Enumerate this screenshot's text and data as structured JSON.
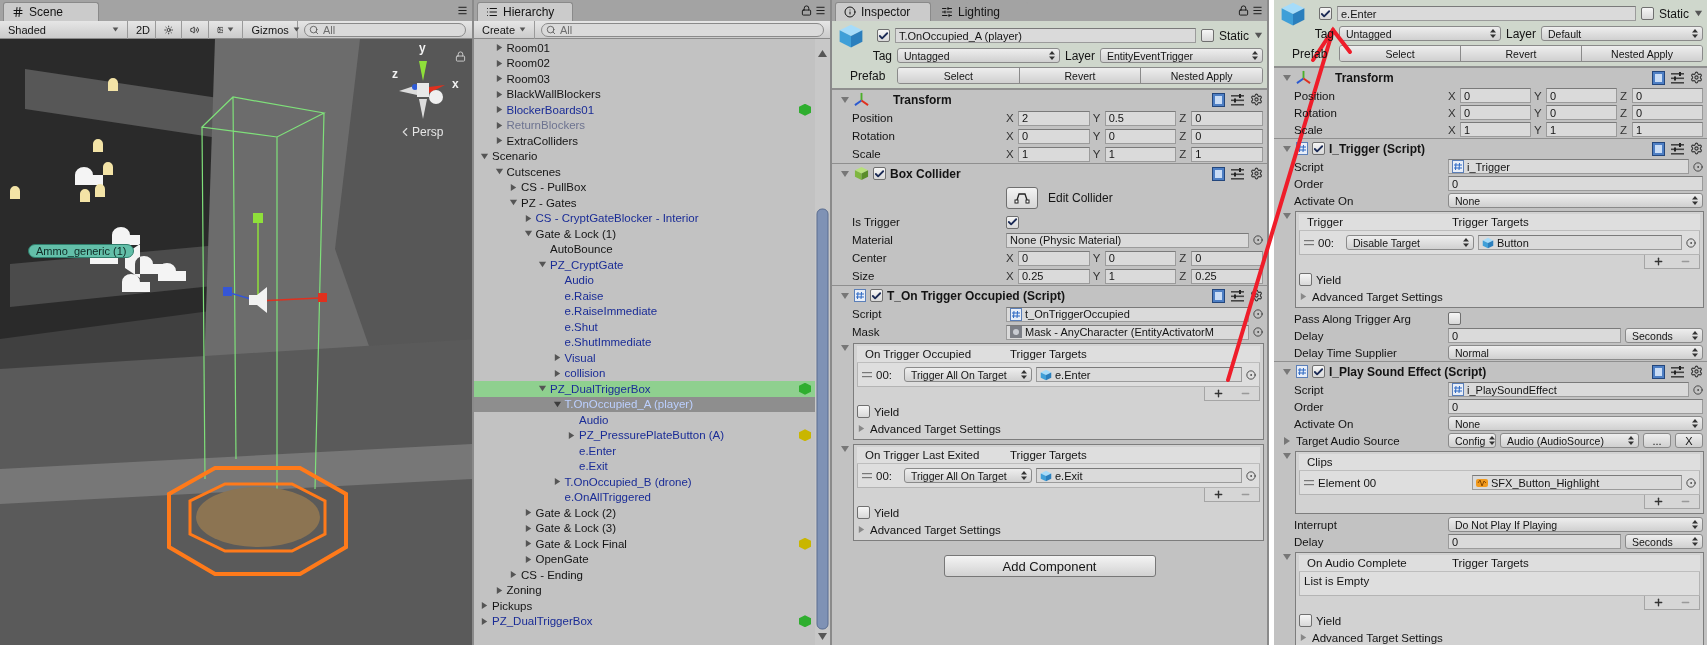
{
  "scene": {
    "tab": "Scene",
    "toolbar": {
      "draw_mode": "Shaded",
      "mode_2d": "2D",
      "lighting_on": false,
      "audio_on": false,
      "gizmos": "Gizmos",
      "search_placeholder": "All"
    },
    "axis_labels": [
      "y",
      "z",
      "x"
    ],
    "projection": "Persp",
    "object_label": "Ammo_generic (1)"
  },
  "hierarchy": {
    "tab": "Hierarchy",
    "create": "Create",
    "search_placeholder": "All",
    "tree": [
      {
        "children": [
          {
            "label": "Room01",
            "kind": "object",
            "expanded": false,
            "selected": false,
            "highlighted": false
          },
          {
            "label": "Room02",
            "kind": "object",
            "expanded": false,
            "selected": false,
            "highlighted": false
          },
          {
            "label": "Room03",
            "kind": "object",
            "expanded": false,
            "selected": false,
            "highlighted": false
          },
          {
            "label": "BlackWallBlockers",
            "kind": "object",
            "expanded": false,
            "selected": false,
            "highlighted": false
          },
          {
            "label": "BlockerBoards01",
            "kind": "prefab",
            "expanded": false,
            "selected": false,
            "highlighted": false,
            "color": "#2fae2f"
          },
          {
            "label": "ReturnBlockers",
            "kind": "inactive_prefab",
            "expanded": false,
            "selected": false,
            "highlighted": false
          },
          {
            "label": "ExtraColliders",
            "kind": "object",
            "expanded": false,
            "selected": false,
            "highlighted": false
          }
        ]
      },
      {
        "label": "Scenario",
        "kind": "object",
        "expanded": true,
        "selected": false,
        "highlighted": false,
        "children": [
          {
            "label": "Cutscenes",
            "kind": "object",
            "expanded": true,
            "selected": false,
            "highlighted": false,
            "children": [
              {
                "label": "CS - PullBox",
                "kind": "object",
                "expanded": false,
                "selected": false,
                "highlighted": false
              },
              {
                "label": "PZ - Gates",
                "kind": "object",
                "expanded": true,
                "selected": false,
                "highlighted": false,
                "children": [
                  {
                    "label": "CS - CryptGateBlocker - Interior",
                    "kind": "prefab",
                    "expanded": false,
                    "selected": false,
                    "highlighted": false
                  },
                  {
                    "label": "Gate & Lock (1)",
                    "kind": "object",
                    "expanded": true,
                    "selected": false,
                    "highlighted": false,
                    "children": [
                      {
                        "label": "AutoBounce",
                        "kind": "object",
                        "selected": false,
                        "highlighted": false
                      },
                      {
                        "label": "PZ_CryptGate",
                        "kind": "prefab",
                        "expanded": true,
                        "selected": false,
                        "highlighted": false,
                        "children": [
                          {
                            "label": "Audio",
                            "kind": "prefab",
                            "selected": false,
                            "highlighted": false
                          },
                          {
                            "label": "e.Raise",
                            "kind": "prefab",
                            "selected": false,
                            "highlighted": false
                          },
                          {
                            "label": "e.RaiseImmediate",
                            "kind": "prefab",
                            "selected": false,
                            "highlighted": false
                          },
                          {
                            "label": "e.Shut",
                            "kind": "prefab",
                            "selected": false,
                            "highlighted": false
                          },
                          {
                            "label": "e.ShutImmediate",
                            "kind": "prefab",
                            "selected": false,
                            "highlighted": false
                          },
                          {
                            "label": "Visual",
                            "kind": "prefab",
                            "expanded": false,
                            "selected": false,
                            "highlighted": false
                          },
                          {
                            "label": "collision",
                            "kind": "prefab",
                            "expanded": false,
                            "selected": false,
                            "highlighted": false
                          }
                        ]
                      },
                      {
                        "label": "PZ_DualTriggerBox",
                        "kind": "prefab",
                        "expanded": true,
                        "selected": false,
                        "highlighted": true,
                        "color": "#2fae2f",
                        "children": [
                          {
                            "label": "T.OnOccupied_A (player)",
                            "kind": "prefab",
                            "expanded": true,
                            "selected": true,
                            "highlighted": false,
                            "children": [
                              {
                                "label": "Audio",
                                "kind": "prefab",
                                "selected": false,
                                "highlighted": false
                              },
                              {
                                "label": "PZ_PressurePlateButton (A)",
                                "kind": "prefab",
                                "expanded": false,
                                "selected": false,
                                "highlighted": false,
                                "color": "#c9b600"
                              },
                              {
                                "label": "e.Enter",
                                "kind": "prefab",
                                "selected": false,
                                "highlighted": false
                              },
                              {
                                "label": "e.Exit",
                                "kind": "prefab",
                                "selected": false,
                                "highlighted": false
                              }
                            ]
                          },
                          {
                            "label": "T.OnOccupied_B (drone)",
                            "kind": "prefab",
                            "expanded": false,
                            "selected": false,
                            "highlighted": false
                          },
                          {
                            "label": "e.OnAllTriggered",
                            "kind": "prefab",
                            "selected": false,
                            "highlighted": false
                          }
                        ]
                      }
                    ]
                  },
                  {
                    "label": "Gate & Lock (2)",
                    "kind": "object",
                    "expanded": false,
                    "selected": false,
                    "highlighted": false
                  },
                  {
                    "label": "Gate & Lock (3)",
                    "kind": "object",
                    "expanded": false,
                    "selected": false,
                    "highlighted": false
                  },
                  {
                    "label": "Gate & Lock Final",
                    "kind": "object",
                    "expanded": false,
                    "selected": false,
                    "highlighted": false,
                    "color": "#c9b600"
                  },
                  {
                    "label": "OpenGate",
                    "kind": "object",
                    "expanded": false,
                    "selected": false,
                    "highlighted": false
                  }
                ]
              },
              {
                "label": "CS - Ending",
                "kind": "object",
                "expanded": false,
                "selected": false,
                "highlighted": false
              }
            ]
          },
          {
            "label": "Zoning",
            "kind": "object",
            "expanded": false,
            "selected": false,
            "highlighted": false
          }
        ]
      },
      {
        "label": "Pickups",
        "kind": "object",
        "expanded": false,
        "selected": false,
        "highlighted": false
      },
      {
        "label": "PZ_DualTriggerBox",
        "kind": "prefab",
        "expanded": false,
        "selected": false,
        "highlighted": false,
        "color": "#2fae2f"
      }
    ]
  },
  "inspector": {
    "tabs": [
      {
        "label": "Inspector",
        "selected": true
      },
      {
        "label": "Lighting",
        "selected": false
      }
    ],
    "object": {
      "active": true,
      "name": "T.OnOccupied_A (player)",
      "static": false,
      "static_label": "Static",
      "tag_label": "Tag",
      "tag": "Untagged",
      "layer_label": "Layer",
      "layer": "EntityEventTrigger",
      "prefab_label": "Prefab",
      "prefab_buttons": [
        "Select",
        "Revert",
        "Nested Apply"
      ]
    },
    "components": [
      {
        "kind": "transform",
        "title": "Transform",
        "expanded": true,
        "rows": [
          {
            "kind": "vector",
            "label": "Position",
            "values": [
              {
                "axis": "X",
                "value": "2"
              },
              {
                "axis": "Y",
                "value": "0.5"
              },
              {
                "axis": "Z",
                "value": "0"
              }
            ]
          },
          {
            "kind": "vector",
            "label": "Rotation",
            "values": [
              {
                "axis": "X",
                "value": "0"
              },
              {
                "axis": "Y",
                "value": "0"
              },
              {
                "axis": "Z",
                "value": "0"
              }
            ]
          },
          {
            "kind": "vector",
            "label": "Scale",
            "values": [
              {
                "axis": "X",
                "value": "1"
              },
              {
                "axis": "Y",
                "value": "1"
              },
              {
                "axis": "Z",
                "value": "1"
              }
            ]
          }
        ]
      },
      {
        "kind": "collider",
        "title": "Box Collider",
        "expanded": true,
        "enabled": true,
        "rows": [
          {
            "kind": "edit_button",
            "label": "Edit Collider"
          },
          {
            "kind": "checkbox",
            "label": "Is Trigger",
            "checked": true
          },
          {
            "kind": "object",
            "label": "Material",
            "value": "None (Physic Material)"
          },
          {
            "kind": "vector",
            "label": "Center",
            "values": [
              {
                "axis": "X",
                "value": "0"
              },
              {
                "axis": "Y",
                "value": "0"
              },
              {
                "axis": "Z",
                "value": "0"
              }
            ]
          },
          {
            "kind": "vector",
            "label": "Size",
            "values": [
              {
                "axis": "X",
                "value": "0.25"
              },
              {
                "axis": "Y",
                "value": "1"
              },
              {
                "axis": "Z",
                "value": "0.25"
              }
            ]
          }
        ]
      },
      {
        "kind": "script",
        "title": "T_On Trigger Occupied (Script)",
        "expanded": true,
        "enabled": true,
        "rows": [
          {
            "kind": "script",
            "label": "Script",
            "value": "t_OnTriggerOccupied"
          },
          {
            "kind": "asset",
            "label": "Mask",
            "value": "Mask - AnyCharacter (EntityActivatorM"
          },
          {
            "kind": "event_list",
            "expanded": true,
            "title": "On Trigger Occupied",
            "targets_title": "Trigger Targets",
            "entries": [
              {
                "index": "00:",
                "action": "Trigger All On Target",
                "target": "e.Enter"
              }
            ],
            "yield": {
              "label": "Yield",
              "checked": false
            },
            "advanced": {
              "label": "Advanced Target Settings",
              "expanded": false
            }
          },
          {
            "kind": "event_list",
            "expanded": true,
            "title": "On Trigger Last Exited",
            "targets_title": "Trigger Targets",
            "entries": [
              {
                "index": "00:",
                "action": "Trigger All On Target",
                "target": "e.Exit"
              }
            ],
            "yield": {
              "label": "Yield",
              "checked": false
            },
            "advanced": {
              "label": "Advanced Target Settings",
              "expanded": false
            }
          }
        ]
      }
    ],
    "add_component": "Add Component"
  },
  "second_inspector": {
    "object": {
      "active": true,
      "name": "e.Enter",
      "static": false,
      "static_label": "Static",
      "tag_label": "Tag",
      "tag": "Untagged",
      "layer_label": "Layer",
      "layer": "Default",
      "prefab_label": "Prefab",
      "prefab_buttons": [
        "Select",
        "Revert",
        "Nested Apply"
      ]
    },
    "components": [
      {
        "kind": "transform",
        "title": "Transform",
        "expanded": true,
        "rows": [
          {
            "kind": "vector",
            "label": "Position",
            "values": [
              {
                "axis": "X",
                "value": "0"
              },
              {
                "axis": "Y",
                "value": "0"
              },
              {
                "axis": "Z",
                "value": "0"
              }
            ]
          },
          {
            "kind": "vector",
            "label": "Rotation",
            "values": [
              {
                "axis": "X",
                "value": "0"
              },
              {
                "axis": "Y",
                "value": "0"
              },
              {
                "axis": "Z",
                "value": "0"
              }
            ]
          },
          {
            "kind": "vector",
            "label": "Scale",
            "values": [
              {
                "axis": "X",
                "value": "1"
              },
              {
                "axis": "Y",
                "value": "1"
              },
              {
                "axis": "Z",
                "value": "1"
              }
            ]
          }
        ]
      },
      {
        "kind": "script",
        "title": "I_Trigger (Script)",
        "expanded": true,
        "enabled": true,
        "rows": [
          {
            "kind": "script",
            "label": "Script",
            "value": "i_Trigger"
          },
          {
            "kind": "number",
            "label": "Order",
            "value": "0"
          },
          {
            "kind": "dropdown",
            "label": "Activate On",
            "value": "None"
          },
          {
            "kind": "event_list",
            "expanded": true,
            "title": "Trigger",
            "targets_title": "Trigger Targets",
            "entries": [
              {
                "index": "00:",
                "action": "Disable Target",
                "target": "Button"
              }
            ],
            "yield": {
              "label": "Yield",
              "checked": false
            },
            "advanced": {
              "label": "Advanced Target Settings",
              "expanded": false
            }
          },
          {
            "kind": "checkbox",
            "label": "Pass Along Trigger Arg",
            "checked": false
          },
          {
            "kind": "number_unit",
            "label": "Delay",
            "value": "0",
            "unit": "Seconds"
          },
          {
            "kind": "dropdown",
            "label": "Delay Time Supplier",
            "value": "Normal"
          }
        ]
      },
      {
        "kind": "script",
        "title": "I_Play Sound Effect (Script)",
        "expanded": true,
        "enabled": true,
        "rows": [
          {
            "kind": "script",
            "label": "Script",
            "value": "i_PlaySoundEffect"
          },
          {
            "kind": "number",
            "label": "Order",
            "value": "0"
          },
          {
            "kind": "dropdown",
            "label": "Activate On",
            "value": "None"
          },
          {
            "kind": "audio_source",
            "label": "Target Audio Source",
            "expanded": false,
            "mode": "Config",
            "source": "Audio (AudioSource)",
            "buttons": [
              "...",
              "X"
            ]
          },
          {
            "kind": "clip_list",
            "expanded": true,
            "title": "Clips",
            "entries": [
              {
                "label": "Element 00",
                "value": "SFX_Button_Highlight"
              }
            ]
          },
          {
            "kind": "dropdown",
            "label": "Interrupt",
            "value": "Do Not Play If Playing"
          },
          {
            "kind": "number_unit",
            "label": "Delay",
            "value": "0",
            "unit": "Seconds"
          },
          {
            "kind": "event_list",
            "expanded": true,
            "title": "On Audio Complete",
            "targets_title": "Trigger Targets",
            "entries": [],
            "empty_text": "List is Empty",
            "yield": {
              "label": "Yield",
              "checked": false
            },
            "advanced": {
              "label": "Advanced Target Settings",
              "expanded": false
            }
          }
        ]
      }
    ]
  }
}
